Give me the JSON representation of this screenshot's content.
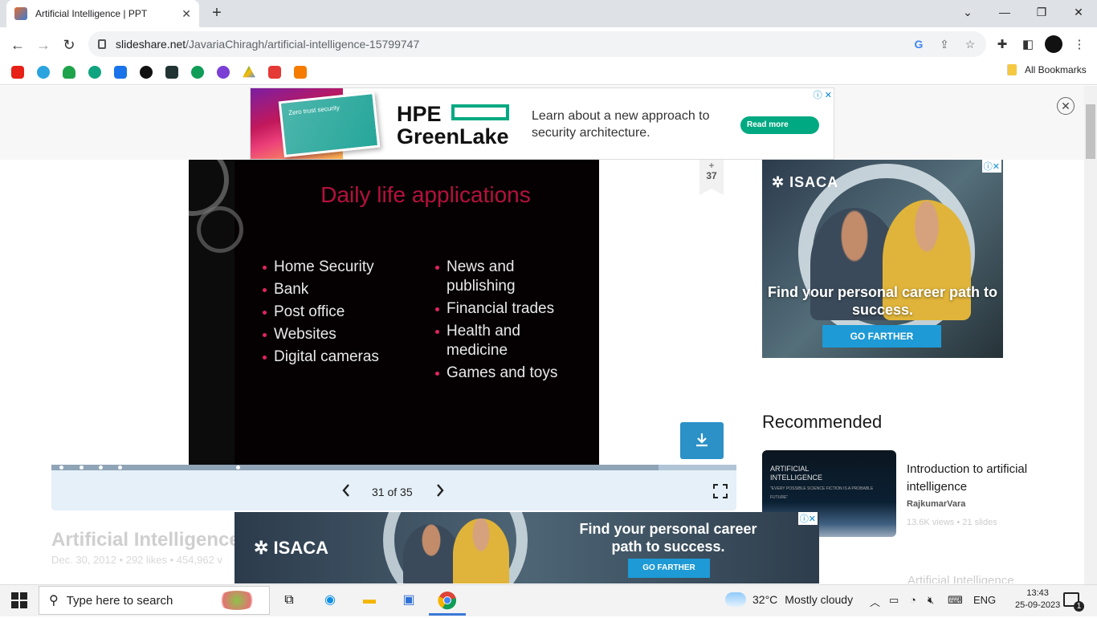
{
  "browser": {
    "tab_title": "Artificial Intelligence | PPT",
    "url_domain": "slideshare.net",
    "url_path": "/JavariaChiragh/artificial-intelligence-15799747",
    "all_bookmarks": "All Bookmarks"
  },
  "top_ad": {
    "brand_line1": "HPE",
    "brand_line2": "GreenLake",
    "copy": "Learn about a new approach to security architecture.",
    "cta": "Read more",
    "book_text": "Zero trust security"
  },
  "slide": {
    "title": "Daily life applications",
    "left_items": [
      "Home Security",
      "Bank",
      "Post office",
      "Websites",
      "Digital cameras"
    ],
    "right_items": [
      "News and publishing",
      "Financial trades",
      "Health and medicine",
      "Games and toys"
    ],
    "page_indicator": "31 of 35",
    "current": 31,
    "total": 35,
    "bookmark_count": "37",
    "bookmark_plus": "+"
  },
  "doc": {
    "title": "Artificial Intelligence",
    "meta": "Dec. 30, 2012  •  292 likes  •  454,962 v"
  },
  "side_ad": {
    "logo": "ISACA",
    "headline": "Find your personal career path to success.",
    "cta": "GO FARTHER"
  },
  "recommended": {
    "heading": "Recommended",
    "items": [
      {
        "thumb_title": "ARTIFICIAL INTELLIGENCE",
        "thumb_sub": "\"EVERY POSSIBLE SCIENCE FICTION IS A PROBABLE FUTURE\"",
        "title": "Introduction to artificial intelligence",
        "author": "RajkumarVara",
        "stats": "13.6K views  •  21 slides"
      },
      {
        "title": "Artificial Intelligence"
      }
    ]
  },
  "bottom_ad": {
    "logo": "ISACA",
    "headline": "Find your personal career path to success.",
    "cta": "GO FARTHER"
  },
  "taskbar": {
    "search_placeholder": "Type here to search",
    "weather_temp": "32°C",
    "weather_desc": "Mostly cloudy",
    "language": "ENG",
    "time": "13:43",
    "date": "25-09-2023",
    "notifications": "1"
  },
  "colors": {
    "slide_title": "#b5113d",
    "bullet": "#e0245e",
    "download_btn": "#2b91c6",
    "hpe_green": "#01a982",
    "isaca_cta": "#1e9ad6"
  }
}
